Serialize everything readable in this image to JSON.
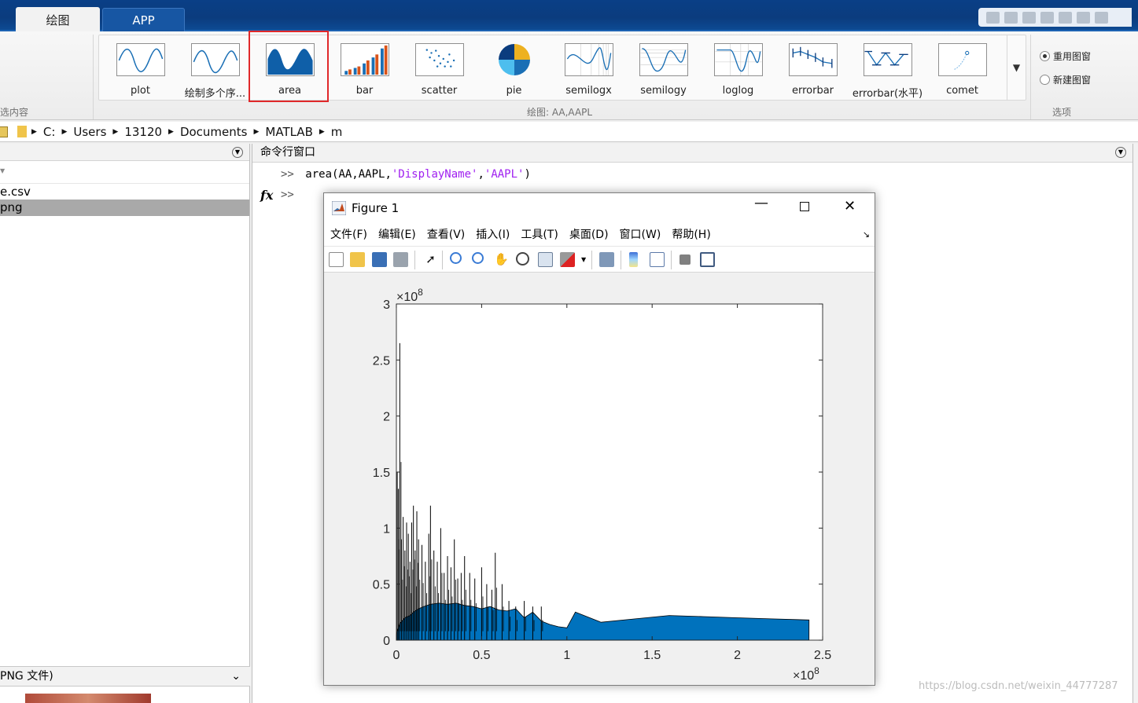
{
  "ribbon": {
    "tabs": [
      {
        "label": "绘图",
        "active": true
      },
      {
        "label": "APP",
        "active": false
      }
    ],
    "gallery": [
      {
        "label": "plot",
        "icon": "plot-icon"
      },
      {
        "label": "绘制多个序...",
        "icon": "multiseries-plot-icon"
      },
      {
        "label": "area",
        "icon": "area-plot-icon"
      },
      {
        "label": "bar",
        "icon": "bar-plot-icon"
      },
      {
        "label": "scatter",
        "icon": "scatter-plot-icon"
      },
      {
        "label": "pie",
        "icon": "pie-plot-icon"
      },
      {
        "label": "semilogx",
        "icon": "semilogx-plot-icon"
      },
      {
        "label": "semilogy",
        "icon": "semilogy-plot-icon"
      },
      {
        "label": "loglog",
        "icon": "loglog-plot-icon"
      },
      {
        "label": "errorbar",
        "icon": "errorbar-plot-icon"
      },
      {
        "label": "errorbar(水平)",
        "icon": "horizontal-errorbar-plot-icon"
      },
      {
        "label": "comet",
        "icon": "comet-plot-icon"
      }
    ],
    "highlighted_item": "area",
    "section_left": "选内容",
    "section_plots": "绘图: AA,AAPL",
    "section_options": "选项",
    "options": [
      {
        "label": "重用图窗",
        "selected": true
      },
      {
        "label": "新建图窗",
        "selected": false
      }
    ]
  },
  "address_bar": {
    "crumbs": [
      "C:",
      "Users",
      "13120",
      "Documents",
      "MATLAB",
      "m"
    ]
  },
  "left_panel": {
    "files": [
      {
        "name": "e.csv",
        "selected": false
      },
      {
        "name": "png",
        "selected": true
      }
    ],
    "details_label": "PNG 文件)"
  },
  "command_window": {
    "title": "命令行窗口",
    "prompt": ">>",
    "history": [
      {
        "cmd": "area(AA,AAPL,",
        "arg1": "'DisplayName'",
        "sep": ",",
        "arg2": "'AAPL'",
        "close": ")"
      }
    ],
    "fx_label": "fx"
  },
  "figure": {
    "title": "Figure 1",
    "menu": [
      "文件(F)",
      "编辑(E)",
      "查看(V)",
      "插入(I)",
      "工具(T)",
      "桌面(D)",
      "窗口(W)",
      "帮助(H)"
    ],
    "toolbar_icons": [
      "new-figure-icon",
      "open-file-icon",
      "save-icon",
      "print-icon",
      "pointer-icon",
      "zoom-in-icon",
      "zoom-out-icon",
      "pan-icon",
      "rotate-3d-icon",
      "data-cursor-icon",
      "brush-icon",
      "link-plot-icon",
      "colorbar-icon",
      "legend-icon",
      "hide-plot-tools-icon",
      "show-plot-tools-icon"
    ]
  },
  "colors": {
    "area_fill": "#0072bd",
    "accent": "#0b4a93",
    "highlight": "#e0282a"
  },
  "chart_data": {
    "type": "area",
    "title": "",
    "xlabel": "",
    "ylabel": "",
    "xlim": [
      0,
      2.5
    ],
    "ylim": [
      0,
      3
    ],
    "x_exponent": "×10^8",
    "y_exponent": "×10^8",
    "xticks": [
      "0",
      "0.5",
      "1",
      "1.5",
      "2",
      "2.5"
    ],
    "yticks": [
      "0",
      "0.5",
      "1",
      "1.5",
      "2",
      "2.5",
      "3"
    ],
    "grid": false,
    "x": [
      0,
      0.02,
      0.05,
      0.08,
      0.1,
      0.13,
      0.16,
      0.2,
      0.25,
      0.3,
      0.35,
      0.4,
      0.45,
      0.5,
      0.55,
      0.6,
      0.65,
      0.7,
      0.75,
      0.8,
      0.85,
      0.9,
      0.95,
      1.0,
      1.05,
      1.2,
      1.4,
      1.6,
      1.8,
      2.0,
      2.2,
      2.42
    ],
    "values": [
      0.05,
      0.15,
      0.2,
      0.22,
      0.25,
      0.28,
      0.3,
      0.32,
      0.33,
      0.32,
      0.33,
      0.31,
      0.3,
      0.28,
      0.3,
      0.27,
      0.26,
      0.28,
      0.2,
      0.25,
      0.17,
      0.14,
      0.12,
      0.11,
      0.25,
      0.16,
      0.19,
      0.22,
      0.21,
      0.2,
      0.19,
      0.18
    ],
    "spikes": {
      "x": [
        0.005,
        0.012,
        0.02,
        0.03,
        0.04,
        0.05,
        0.06,
        0.07,
        0.08,
        0.09,
        0.1,
        0.11,
        0.12,
        0.13,
        0.15,
        0.17,
        0.19,
        0.2,
        0.22,
        0.24,
        0.26,
        0.28,
        0.3,
        0.32,
        0.34,
        0.36,
        0.38,
        0.4,
        0.43,
        0.46,
        0.5,
        0.53,
        0.56,
        0.58,
        0.62,
        0.66,
        0.7,
        0.75,
        0.8,
        0.85
      ],
      "values": [
        1.5,
        1.35,
        2.65,
        0.9,
        1.1,
        0.8,
        1.05,
        0.95,
        0.7,
        1.05,
        1.2,
        0.8,
        1.15,
        0.9,
        0.85,
        0.7,
        0.95,
        1.2,
        0.8,
        0.7,
        1.0,
        0.6,
        0.75,
        0.65,
        0.9,
        0.55,
        0.6,
        0.75,
        0.6,
        0.55,
        0.65,
        0.5,
        0.45,
        0.78,
        0.5,
        0.35,
        0.3,
        0.35,
        0.3,
        0.3
      ]
    }
  }
}
